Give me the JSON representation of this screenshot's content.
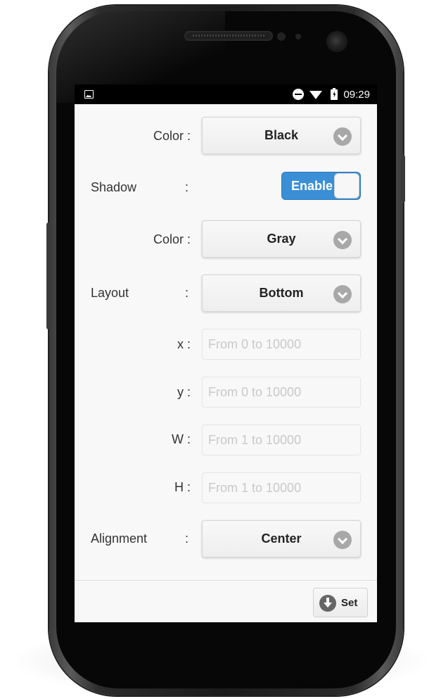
{
  "status_bar": {
    "time": "09:29",
    "icons": [
      "image-icon",
      "do-not-disturb-icon",
      "wifi-icon",
      "battery-charging-icon"
    ]
  },
  "form": {
    "color_label": "Color :",
    "color_value": "Black",
    "shadow_label": "Shadow",
    "shadow_colon": ":",
    "shadow_toggle_label": "Enable",
    "shadow_enabled": true,
    "shadow_color_label": "Color :",
    "shadow_color_value": "Gray",
    "layout_label": "Layout",
    "layout_colon": ":",
    "layout_value": "Bottom",
    "x_label": "x :",
    "x_placeholder": "From 0 to 10000",
    "x_value": "",
    "y_label": "y :",
    "y_placeholder": "From 0 to 10000",
    "y_value": "",
    "w_label": "W :",
    "w_placeholder": "From 1 to 10000",
    "w_value": "",
    "h_label": "H :",
    "h_placeholder": "From 1 to 10000",
    "h_value": "",
    "alignment_label": "Alignment",
    "alignment_colon": ":",
    "alignment_value": "Center"
  },
  "footer": {
    "set_label": "Set"
  },
  "colors": {
    "accent": "#3a8fd6",
    "screen_bg": "#f8f8f8",
    "status_bar_bg": "#000000"
  }
}
